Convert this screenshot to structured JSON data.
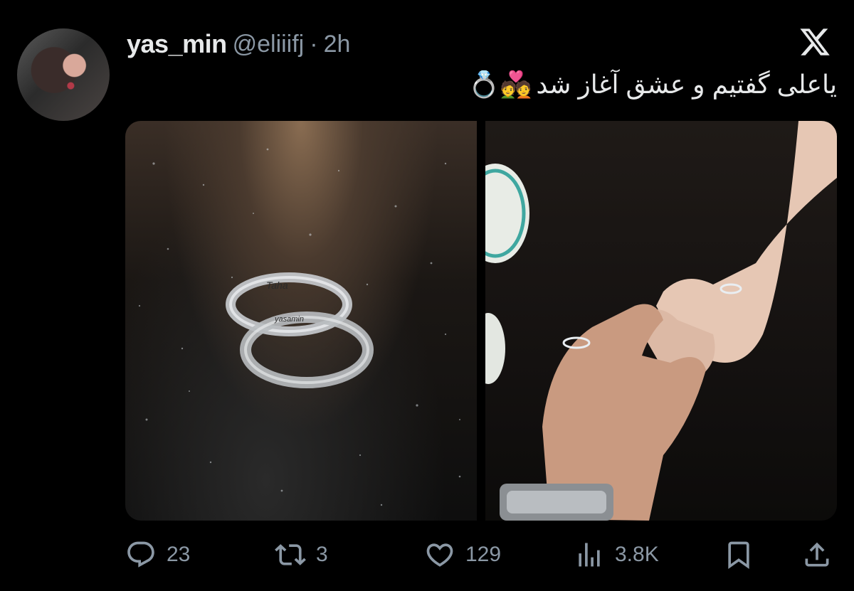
{
  "tweet": {
    "display_name": "yas_min",
    "handle": "@eliiifj",
    "separator": "·",
    "time": "2h",
    "text": "یاعلی گفتیم و عشق آغاز شد",
    "emojis": "💑💍"
  },
  "media": {
    "ring_engraving_1": "Taha",
    "ring_engraving_2": "yasamin"
  },
  "stats": {
    "replies": "23",
    "retweets": "3",
    "likes": "129",
    "views": "3.8K"
  },
  "icons": {
    "logo": "x-logo-icon",
    "reply": "reply-icon",
    "retweet": "retweet-icon",
    "like": "heart-icon",
    "views": "views-icon",
    "bookmark": "bookmark-icon",
    "share": "share-icon"
  },
  "colors": {
    "background": "#000000",
    "text": "#e7e9ea",
    "muted": "#8b98a5"
  }
}
